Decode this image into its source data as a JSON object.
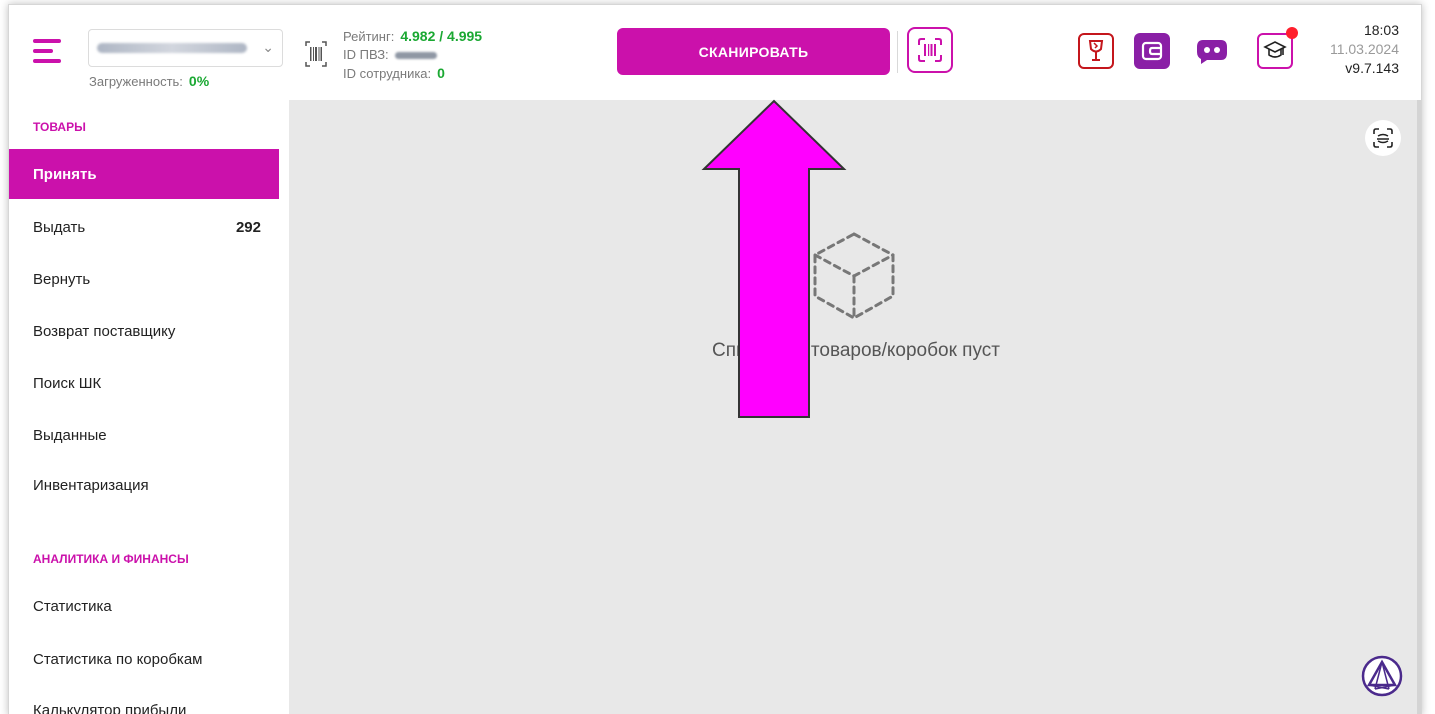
{
  "header": {
    "load_label": "Загруженность:",
    "load_value": "0%",
    "rating_label": "Рейтинг:",
    "rating_value": "4.982 / 4.995",
    "pvz_label": "ID ПВЗ:",
    "employee_label": "ID сотрудника:",
    "employee_value": "0",
    "scan_button": "СКАНИРОВАТЬ",
    "time": "18:03",
    "date": "11.03.2024",
    "version": "v9.7.143"
  },
  "sidebar": {
    "section_goods": "ТОВАРЫ",
    "items": [
      {
        "label": "Принять",
        "count": ""
      },
      {
        "label": "Выдать",
        "count": "292"
      },
      {
        "label": "Вернуть",
        "count": ""
      },
      {
        "label": "Возврат поставщику",
        "count": ""
      },
      {
        "label": "Поиск ШК",
        "count": ""
      },
      {
        "label": "Выданные",
        "count": ""
      },
      {
        "label": "Инвентаризация",
        "count": ""
      }
    ],
    "section_finance": "АНАЛИТИКА И ФИНАНСЫ",
    "finance_items": [
      {
        "label": "Статистика"
      },
      {
        "label": "Статистика по коробкам"
      },
      {
        "label": "Калькулятор прибыли"
      }
    ]
  },
  "main": {
    "empty_text": "Список п        х товаров/коробок пуст"
  },
  "colors": {
    "accent": "#cb11ab",
    "green": "#1aa832",
    "arrow": "#ff00ff"
  },
  "icons": [
    "menu-icon",
    "barcode-icon",
    "scanner-icon",
    "fragile-glass-icon",
    "wallet-icon",
    "chat-bot-icon",
    "education-cap-icon",
    "scan-frame-icon",
    "cube-icon",
    "brand-logo-icon"
  ]
}
